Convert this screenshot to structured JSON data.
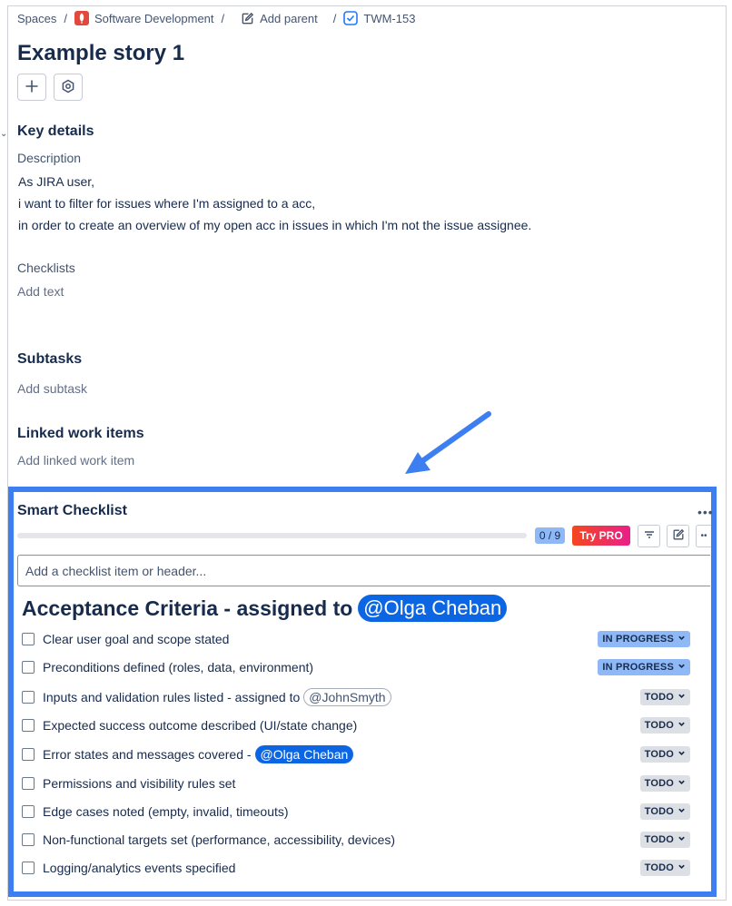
{
  "breadcrumb": {
    "spaces": "Spaces",
    "project": "Software Development",
    "add_parent": "Add parent",
    "issue_key": "TWM-153"
  },
  "issue": {
    "title": "Example story 1"
  },
  "key_details": {
    "heading": "Key details",
    "description_label": "Description",
    "description_lines": [
      "As JIRA user,",
      "i want to filter for issues where I'm assigned to a acc,",
      "in order to create an overview of my open acc in issues in which I'm not the issue assignee."
    ],
    "checklists_label": "Checklists",
    "checklists_placeholder": "Add text"
  },
  "subtasks": {
    "heading": "Subtasks",
    "add_label": "Add subtask"
  },
  "linked_items": {
    "heading": "Linked work items",
    "add_label": "Add linked work item"
  },
  "smart_checklist": {
    "title": "Smart Checklist",
    "progress_text": "0 / 9",
    "progress_fraction": 0,
    "try_pro_label": "Try PRO",
    "input_placeholder": "Add a checklist item or header...",
    "header_text": "Acceptance Criteria - assigned to",
    "header_mention": "@Olga Cheban",
    "items": [
      {
        "text": "Clear user goal and scope stated",
        "mention": "",
        "status": "IN PROGRESS"
      },
      {
        "text": "Preconditions defined (roles, data, environment)",
        "mention": "",
        "status": "IN PROGRESS"
      },
      {
        "text": "Inputs and validation rules listed - assigned to",
        "mention": "@JohnSmyth",
        "status": "TODO"
      },
      {
        "text": "Expected success outcome described (UI/state change)",
        "mention": "",
        "status": "TODO"
      },
      {
        "text": "Error states and messages covered -",
        "mention": "@Olga Cheban",
        "status": "TODO"
      },
      {
        "text": "Permissions and visibility rules set",
        "mention": "",
        "status": "TODO"
      },
      {
        "text": "Edge cases noted (empty, invalid, timeouts)",
        "mention": "",
        "status": "TODO"
      },
      {
        "text": "Non-functional targets set (performance, accessibility, devices)",
        "mention": "",
        "status": "TODO"
      },
      {
        "text": "Logging/analytics events specified",
        "mention": "",
        "status": "TODO"
      }
    ]
  },
  "colors": {
    "highlight_border": "#3d7ff0",
    "mention_blue": "#0c66e4",
    "in_progress_bg": "#8fb8f6",
    "todo_bg": "#dcdfe4"
  },
  "icons": {
    "project": "rocket-project-icon",
    "add_parent": "edit-icon",
    "issue_type": "checkbox-task-icon",
    "add": "plus-icon",
    "settings": "hexagon-gear-icon",
    "filter": "filter-icon",
    "edit": "edit-icon",
    "more": "more-icon",
    "arrow": "annotation-arrow-icon"
  }
}
